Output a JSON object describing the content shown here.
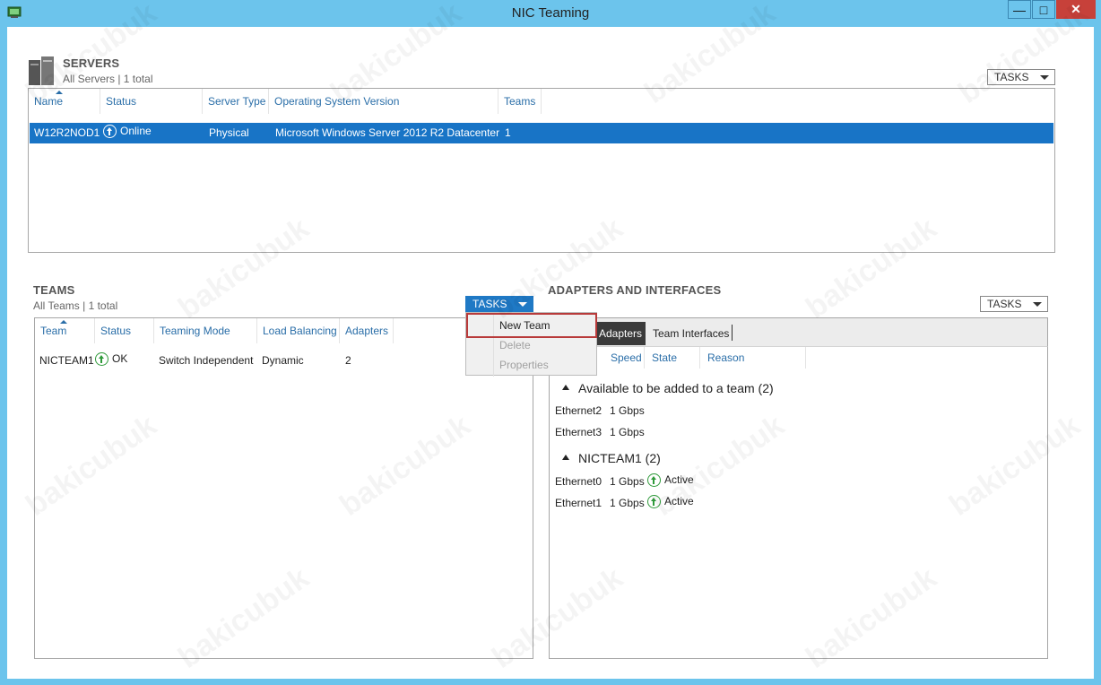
{
  "window": {
    "title": "NIC Teaming",
    "controls": {
      "minimize": "—",
      "maximize": "□",
      "close": "✕"
    }
  },
  "servers": {
    "title": "SERVERS",
    "subtitle": "All Servers | 1 total",
    "tasks_label": "TASKS",
    "columns": [
      "Name",
      "Status",
      "Server Type",
      "Operating System Version",
      "Teams"
    ],
    "rows": [
      {
        "name": "W12R2NOD1",
        "status": "Online",
        "server_type": "Physical",
        "os": "Microsoft Windows Server 2012 R2 Datacenter",
        "teams": "1"
      }
    ]
  },
  "teams": {
    "title": "TEAMS",
    "subtitle": "All Teams | 1 total",
    "tasks_label": "TASKS",
    "columns": [
      "Team",
      "Status",
      "Teaming Mode",
      "Load Balancing",
      "Adapters"
    ],
    "rows": [
      {
        "team": "NICTEAM1",
        "status": "OK",
        "mode": "Switch Independent",
        "balancing": "Dynamic",
        "adapters": "2"
      }
    ],
    "menu": {
      "items": [
        {
          "label": "New Team",
          "enabled": true
        },
        {
          "label": "Delete",
          "enabled": false
        },
        {
          "label": "Properties",
          "enabled": false
        }
      ]
    }
  },
  "adapters": {
    "title": "ADAPTERS AND INTERFACES",
    "tasks_label": "TASKS",
    "tabs": [
      "Adapters",
      "Team Interfaces"
    ],
    "columns": [
      "Speed",
      "State",
      "Reason"
    ],
    "groups": [
      {
        "label": "Available to be added to a team (2)",
        "rows": [
          {
            "name": "Ethernet2",
            "speed": "1 Gbps",
            "state": ""
          },
          {
            "name": "Ethernet3",
            "speed": "1 Gbps",
            "state": ""
          }
        ]
      },
      {
        "label": "NICTEAM1 (2)",
        "rows": [
          {
            "name": "Ethernet0",
            "speed": "1 Gbps",
            "state": "Active"
          },
          {
            "name": "Ethernet1",
            "speed": "1 Gbps",
            "state": "Active"
          }
        ]
      }
    ]
  },
  "watermark": "bakicubuk"
}
